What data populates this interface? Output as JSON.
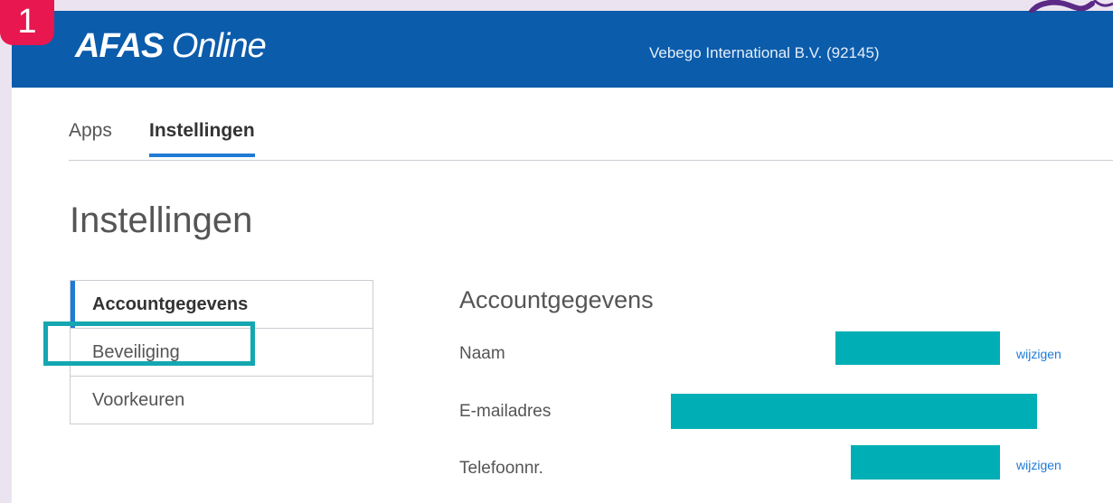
{
  "step_badge": "1",
  "header": {
    "logo_bold": "AFAS",
    "logo_rest": "Online",
    "organization": "Vebego International B.V. (92145)"
  },
  "tabs": [
    {
      "label": "Apps"
    },
    {
      "label": "Instellingen"
    }
  ],
  "page_title": "Instellingen",
  "sidebar": {
    "items": [
      {
        "label": "Accountgegevens"
      },
      {
        "label": "Beveiliging"
      },
      {
        "label": "Voorkeuren"
      }
    ]
  },
  "account": {
    "title": "Accountgegevens",
    "fields": [
      {
        "label": "Naam",
        "action": "wijzigen"
      },
      {
        "label": "E-mailadres"
      },
      {
        "label": "Telefoonnr.",
        "action": "wijzigen"
      }
    ]
  },
  "colors": {
    "brand_blue": "#0b5cab",
    "accent_blue": "#1e7bd6",
    "highlight_teal": "#14a7b1",
    "redaction_teal": "#00aeb5",
    "badge_red": "#e8174f"
  }
}
